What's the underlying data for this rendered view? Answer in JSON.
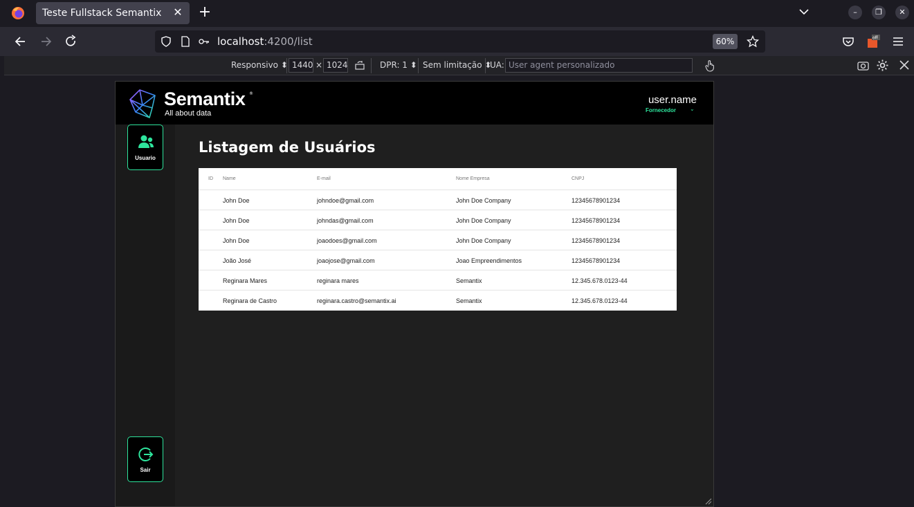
{
  "browser": {
    "tab_title": "Teste Fullstack Semantix",
    "url_host": "localhost",
    "url_path": ":4200/list",
    "zoom": "60%"
  },
  "rdm": {
    "device": "Responsivo",
    "width": "1440",
    "times": "×",
    "height": "1024",
    "dpr": "DPR: 1",
    "throttle": "Sem limitação",
    "ua_label": "UA:",
    "ua_placeholder": "User agent personalizado"
  },
  "header": {
    "brand": "Semantix",
    "brand_mark": "®",
    "tagline": "All about data",
    "username": "user.name",
    "role": "Fornecedor"
  },
  "sidebar": {
    "user_label": "Usuario",
    "logout_label": "Sair"
  },
  "page": {
    "title": "Listagem de Usuários"
  },
  "table": {
    "columns": [
      "ID",
      "Name",
      "E-mail",
      "Nome Empresa",
      "CNPJ"
    ],
    "rows": [
      {
        "id": "",
        "name": "John Doe",
        "email": "johndoe@gmail.com",
        "company": "John Doe Company",
        "cnpj": "12345678901234"
      },
      {
        "id": "",
        "name": "John Doe",
        "email": "johndas@gmail.com",
        "company": "John Doe Company",
        "cnpj": "12345678901234"
      },
      {
        "id": "",
        "name": "John Doe",
        "email": "joaodoes@gmail.com",
        "company": "John Doe Company",
        "cnpj": "12345678901234"
      },
      {
        "id": "",
        "name": "João José",
        "email": "joaojose@gmail.com",
        "company": "Joao Empreendimentos",
        "cnpj": "12345678901234"
      },
      {
        "id": "",
        "name": "Reginara Mares",
        "email": "reginara mares",
        "company": "Semantix",
        "cnpj": "12.345.678.0123-44"
      },
      {
        "id": "",
        "name": "Reginara de Castro",
        "email": "reginara.castro@semantix.ai",
        "company": "Semantix",
        "cnpj": "12.345.678.0123-44"
      }
    ]
  },
  "colors": {
    "accent": "#2ee59d",
    "header_bg": "#000000",
    "page_bg": "#1f1f1f"
  }
}
